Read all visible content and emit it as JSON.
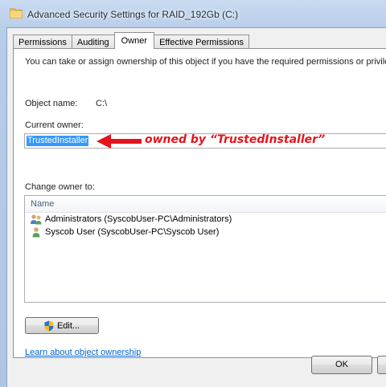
{
  "window": {
    "title": "Advanced Security Settings for RAID_192Gb (C:)"
  },
  "tabs": [
    {
      "label": "Permissions",
      "active": false
    },
    {
      "label": "Auditing",
      "active": false
    },
    {
      "label": "Owner",
      "active": true
    },
    {
      "label": "Effective Permissions",
      "active": false
    }
  ],
  "owner_tab": {
    "intro": "You can take or assign ownership of this object if you have the required permissions or privileges.",
    "object_name_label": "Object name:",
    "object_name_value": "C:\\",
    "current_owner_label": "Current owner:",
    "current_owner_value": "TrustedInstaller",
    "change_owner_label": "Change owner to:",
    "list_header": "Name",
    "owners": [
      {
        "name": "Administrators (SyscobUser-PC\\Administrators)",
        "icon": "group-icon"
      },
      {
        "name": "Syscob User (SyscobUser-PC\\Syscob User)",
        "icon": "user-icon"
      }
    ],
    "edit_button": "Edit...",
    "learn_link": "Learn about object ownership"
  },
  "buttons": {
    "ok": "OK"
  },
  "annotation": {
    "text": "owned by “TrustedInstaller”",
    "color": "#e5141c"
  },
  "colors": {
    "selection": "#3399ff",
    "link": "#0066cc"
  }
}
